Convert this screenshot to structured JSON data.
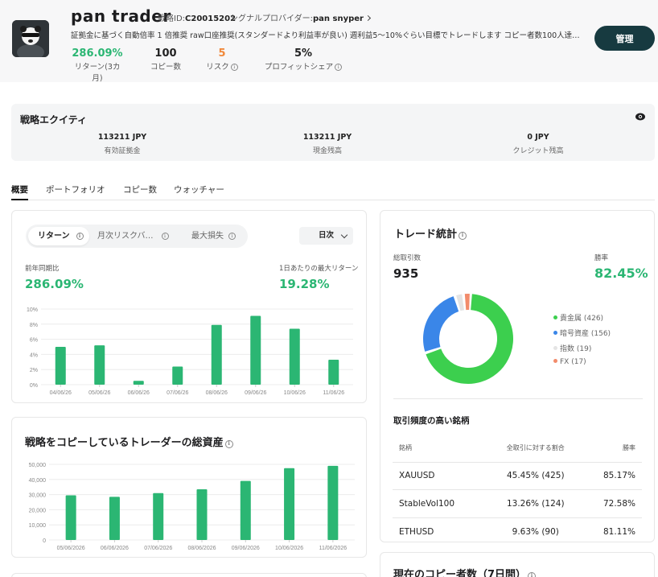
{
  "header": {
    "trader_name": "pan trader",
    "strategy_id_label": "戦略ID:",
    "strategy_id": "C20015202",
    "provider_label": "シグナルプロバイダー:",
    "provider_name": "pan snyper",
    "description": "証拠金に基づく自動倍率 1 倍推奨 raw口座推奨(スタンダードより利益率が良い) 週利益5〜10%ぐらい目標でトレードします コピー者数100人達成で...",
    "manage_label": "管理",
    "stats": [
      {
        "value": "286.09%",
        "label": "リターン(3カ月)",
        "color": "#2bb673"
      },
      {
        "value": "100",
        "label": "コピー数",
        "color": "#222222"
      },
      {
        "value": "5",
        "label": "リスク",
        "color": "#f0883a"
      },
      {
        "value": "5%",
        "label": "プロフィットシェア",
        "color": "#222222"
      }
    ]
  },
  "equity": {
    "title": "戦略エクイティ",
    "items": [
      {
        "value": "113211 JPY",
        "label": "有効証拠金"
      },
      {
        "value": "113211 JPY",
        "label": "現金残高"
      },
      {
        "value": "0 JPY",
        "label": "クレジット残高"
      }
    ]
  },
  "tabs": [
    "概要",
    "ポートフォリオ",
    "コピー数",
    "ウォッチャー"
  ],
  "returns_card": {
    "segments": [
      "リターン",
      "月次リスクバ…",
      "最大損失"
    ],
    "period": "日次",
    "yoy_label": "前年同期比",
    "yoy_value": "286.09%",
    "max_daily_label": "1日あたりの最大リターン",
    "max_daily_value": "19.28%"
  },
  "assets_card": {
    "title": "戦略をコピーしているトレーダーの総資産"
  },
  "trade_stats": {
    "title": "トレード統計",
    "total_label": "総取引数",
    "total_value": "935",
    "win_label": "勝率",
    "win_value": "82.45%",
    "legend": [
      {
        "label": "貴金属 (426)",
        "value": 426,
        "color": "#3ccf4e"
      },
      {
        "label": "暗号資産 (156)",
        "value": 156,
        "color": "#3a86e8"
      },
      {
        "label": "指数 (19)",
        "value": 19,
        "color": "#e4e4e4"
      },
      {
        "label": "FX (17)",
        "value": 17,
        "color": "#f28b6b"
      }
    ],
    "symbols_title": "取引頻度の高い銘柄",
    "table_headers": [
      "銘柄",
      "全取引に対する割合",
      "勝率"
    ],
    "rows": [
      [
        "XAUUSD",
        "45.45% (425)",
        "85.17%"
      ],
      [
        "StableVol100",
        "13.26% (124)",
        "72.58%"
      ],
      [
        "ETHUSD",
        "9.63% (90)",
        "81.11%"
      ]
    ]
  },
  "copiers_card": {
    "title": "現在のコピー者数（7日間）"
  },
  "chart_data": [
    {
      "type": "bar",
      "categories": [
        "04/06/26",
        "05/06/26",
        "06/06/26",
        "07/06/26",
        "08/06/26",
        "09/06/26",
        "10/06/26",
        "11/06/26"
      ],
      "values": [
        5.0,
        5.2,
        0.5,
        2.4,
        7.9,
        9.1,
        7.4,
        3.3
      ],
      "yticks": [
        "0%",
        "2%",
        "4%",
        "6%",
        "8%",
        "10%"
      ],
      "ylim": [
        0,
        10
      ],
      "color": "#2bb673"
    },
    {
      "type": "bar",
      "title": "戦略をコピーしているトレーダーの総資産",
      "categories": [
        "05/06/2026",
        "06/06/2026",
        "07/06/2026",
        "08/06/2026",
        "09/06/2026",
        "10/06/2026",
        "11/06/2026"
      ],
      "values": [
        29500,
        28500,
        31000,
        33500,
        39000,
        47500,
        49000
      ],
      "yticks": [
        "0",
        "10,000",
        "20,000",
        "30,000",
        "40,000",
        "50,000"
      ],
      "ylim": [
        0,
        50000
      ],
      "color": "#2bb673"
    },
    {
      "type": "pie",
      "categories": [
        "貴金属",
        "暗号資産",
        "指数",
        "FX"
      ],
      "values": [
        426,
        156,
        19,
        17
      ],
      "colors": [
        "#3ccf4e",
        "#3a86e8",
        "#e4e4e4",
        "#f28b6b"
      ]
    }
  ]
}
